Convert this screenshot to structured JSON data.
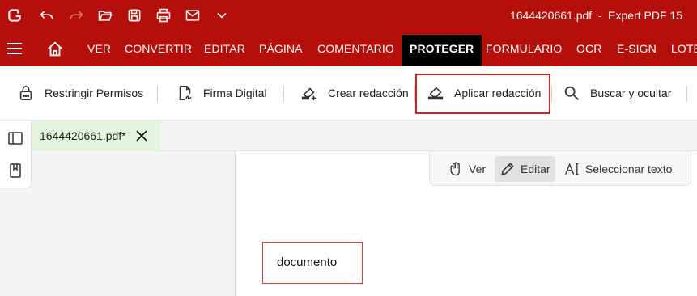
{
  "titlebar": {
    "filename": "1644420661.pdf",
    "separator": "-",
    "app_name": "Expert PDF 15",
    "quick_access": [
      "app-logo-icon",
      "undo-icon",
      "redo-icon",
      "open-folder-icon",
      "save-icon",
      "print-icon",
      "email-icon",
      "chevron-down-icon"
    ]
  },
  "menubar": {
    "tabs": [
      "VER",
      "CONVERTIR",
      "EDITAR",
      "PÁGINA",
      "COMENTARIO",
      "PROTEGER",
      "FORMULARIO",
      "OCR",
      "E-SIGN",
      "LOTE"
    ],
    "active_tab": "PROTEGER"
  },
  "ribbon": {
    "restrict": "Restringir Permisos",
    "sign": "Firma Digital",
    "create_redaction": "Crear redacción",
    "apply_redaction": "Aplicar redacción",
    "search_hide": "Buscar y ocultar"
  },
  "document_tab": {
    "label": "1644420661.pdf*"
  },
  "modes": {
    "view": "Ver",
    "edit": "Editar",
    "select_text": "Seleccionar texto",
    "active": "Editar"
  },
  "page": {
    "text": "documento"
  },
  "colors": {
    "brand": "#b50f0b",
    "active_tab": "#000000",
    "highlight": "#d81b1b",
    "doc_tab": "#e5f5dd"
  }
}
